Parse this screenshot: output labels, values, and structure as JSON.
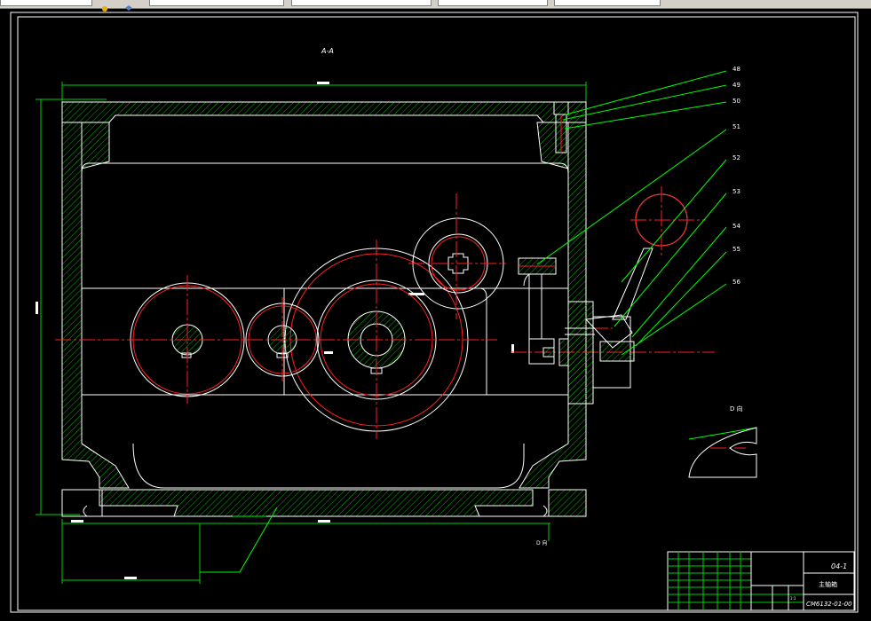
{
  "colors": {
    "background": "#000000",
    "outline": "#ffffff",
    "hatch": "#00c000",
    "gear_pitch": "#ff0000",
    "leader": "#00ff00",
    "toolbar": "#d4d0c8"
  },
  "toolbar": {
    "icons": [
      "undo-icon",
      "cube-icon"
    ]
  },
  "drawing": {
    "section_label": "A-A",
    "view_label_d": "D 向",
    "view_label_d2": "D 向",
    "part_numbers": [
      "48",
      "49",
      "50",
      "51",
      "52",
      "53",
      "54",
      "55",
      "56"
    ]
  },
  "title_block": {
    "code_top": "04-1",
    "part_name": "主轴箱",
    "drawing_no": "CM6132-01-00",
    "scale": "1:1"
  }
}
